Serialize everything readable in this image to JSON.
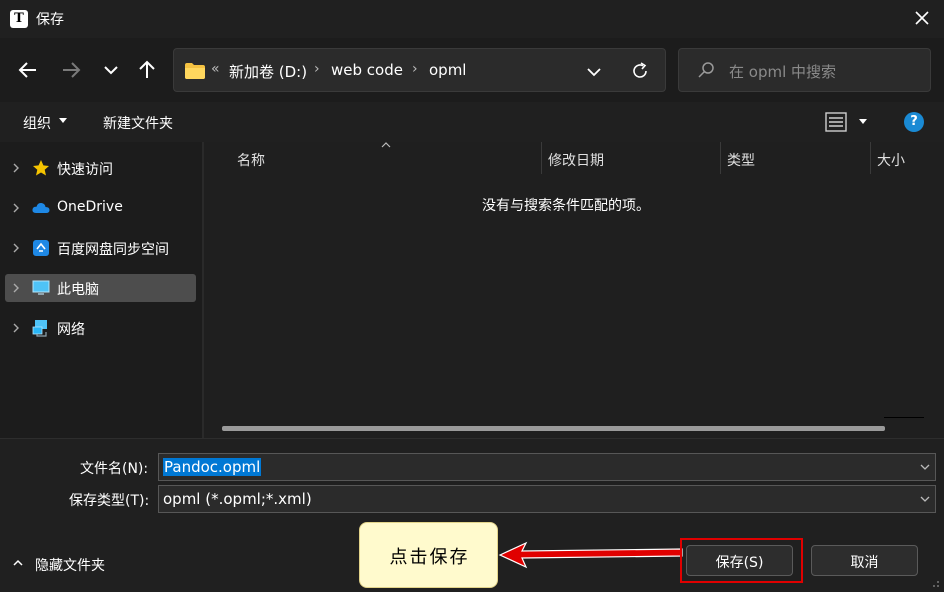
{
  "window": {
    "title": "保存",
    "app_icon_letter": "T"
  },
  "address": {
    "overflow_marker": "«",
    "crumbs": [
      "新加卷 (D:)",
      "web code",
      "opml"
    ],
    "separator": "›"
  },
  "search": {
    "placeholder": "在 opml 中搜索"
  },
  "toolbar": {
    "organize": "组织",
    "new_folder": "新建文件夹",
    "help": "?"
  },
  "sidebar": {
    "items": [
      {
        "label": "快速访问",
        "icon": "star-icon",
        "color": "#f5c400"
      },
      {
        "label": "OneDrive",
        "icon": "cloud-icon",
        "color": "#1e88e5"
      },
      {
        "label": "百度网盘同步空间",
        "icon": "baidu-netdisk-icon",
        "color": "#1e88e5"
      },
      {
        "label": "此电脑",
        "icon": "computer-icon",
        "color": "#4fc3f7",
        "selected": true
      },
      {
        "label": "网络",
        "icon": "network-icon",
        "color": "#4fc3f7"
      }
    ]
  },
  "columns": [
    "名称",
    "修改日期",
    "类型",
    "大小"
  ],
  "empty_message": "没有与搜索条件匹配的项。",
  "filename": {
    "label": "文件名(N):",
    "value": "Pandoc.opml"
  },
  "filetype": {
    "label": "保存类型(T):",
    "value": "opml (*.opml;*.xml)"
  },
  "hide_folders": "隐藏文件夹",
  "callout": {
    "text": "点击保存"
  },
  "buttons": {
    "save": "保存(S)",
    "cancel": "取消"
  },
  "colors": {
    "accent": "#0078d4",
    "highlight_frame": "#e00000",
    "callout_bg": "#fffacd"
  }
}
